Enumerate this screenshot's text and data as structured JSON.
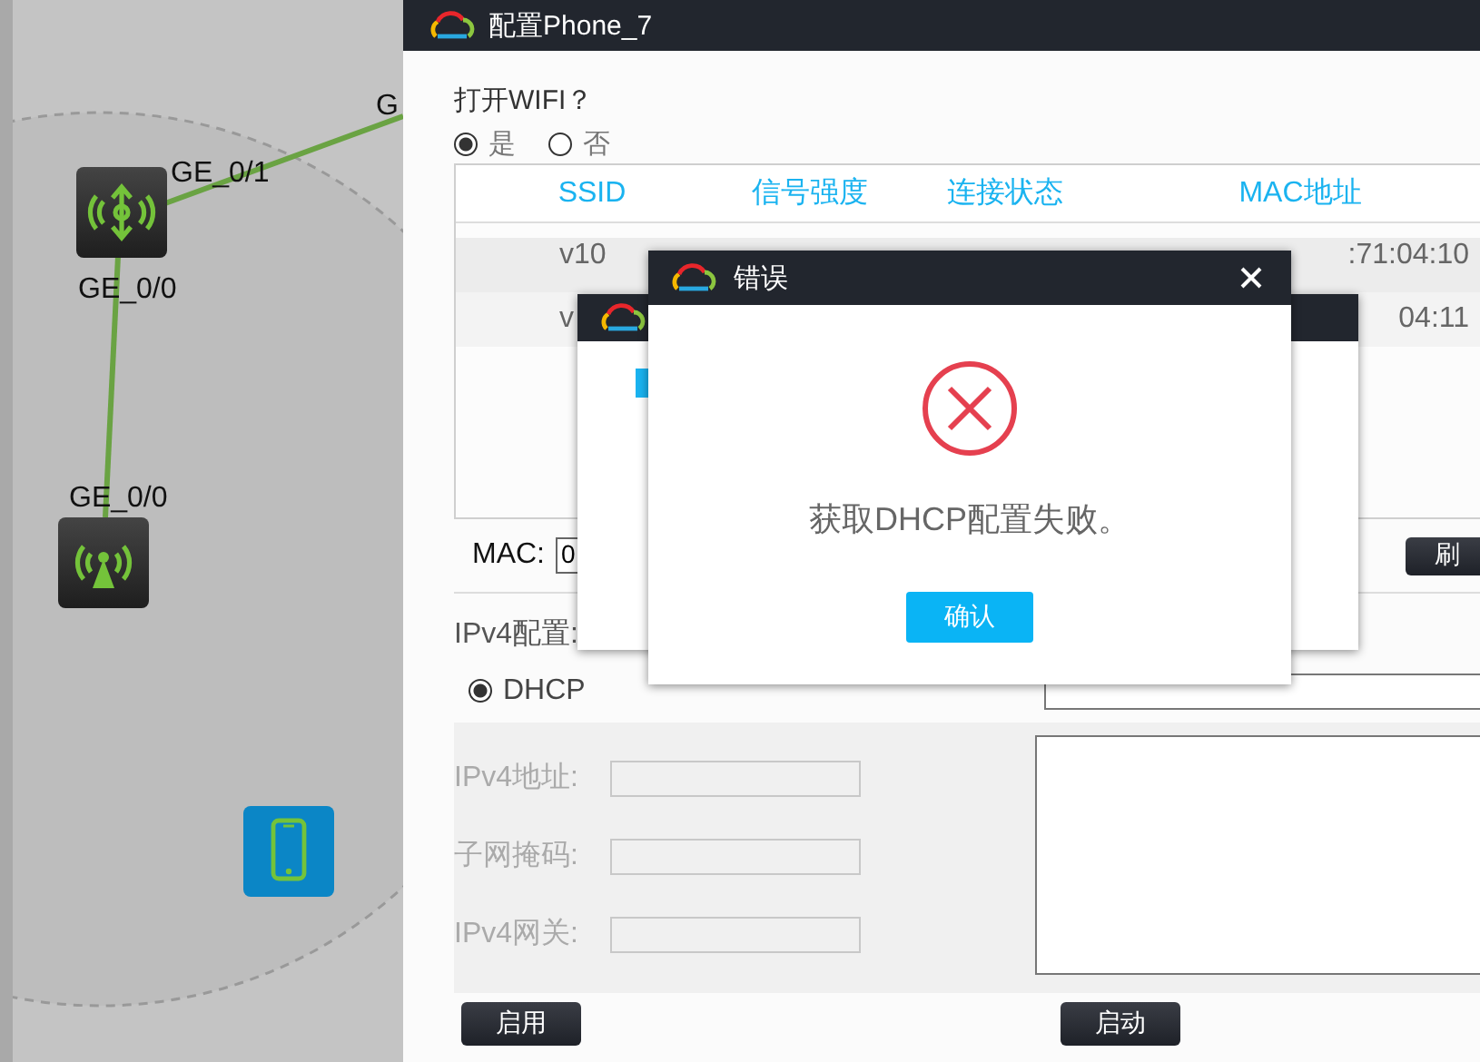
{
  "canvas": {
    "link_labels": [
      "G",
      "GE_0/1",
      "GE_0/0",
      "GE_0/0"
    ],
    "devices": [
      {
        "kind": "router"
      },
      {
        "kind": "access-point"
      },
      {
        "kind": "phone"
      }
    ]
  },
  "window": {
    "title": "配置Phone_7",
    "wifi": {
      "question": "打开WIFI？",
      "options": [
        {
          "label": "是",
          "selected": true
        },
        {
          "label": "否",
          "selected": false
        }
      ]
    },
    "table": {
      "columns": [
        "SSID",
        "信号强度",
        "连接状态",
        "MAC地址"
      ],
      "rows": [
        [
          "v10",
          "",
          "",
          ":71:04:10"
        ],
        [
          "v",
          "",
          "",
          "04:11"
        ]
      ]
    },
    "mac": {
      "label": "MAC:",
      "value": "0",
      "button": "刷"
    },
    "ipv4": {
      "title": "IPv4配置:",
      "mode": {
        "label": "DHCP",
        "selected": true
      },
      "disabled": true,
      "fields": [
        {
          "label": "IPv4地址:"
        },
        {
          "label": "子网掩码:"
        },
        {
          "label": "IPv4网关:"
        }
      ]
    },
    "buttons": [
      "启用",
      "启动"
    ]
  },
  "error_dialog": {
    "title": "错误",
    "message": "获取DHCP配置失败。",
    "button": "确认"
  }
}
